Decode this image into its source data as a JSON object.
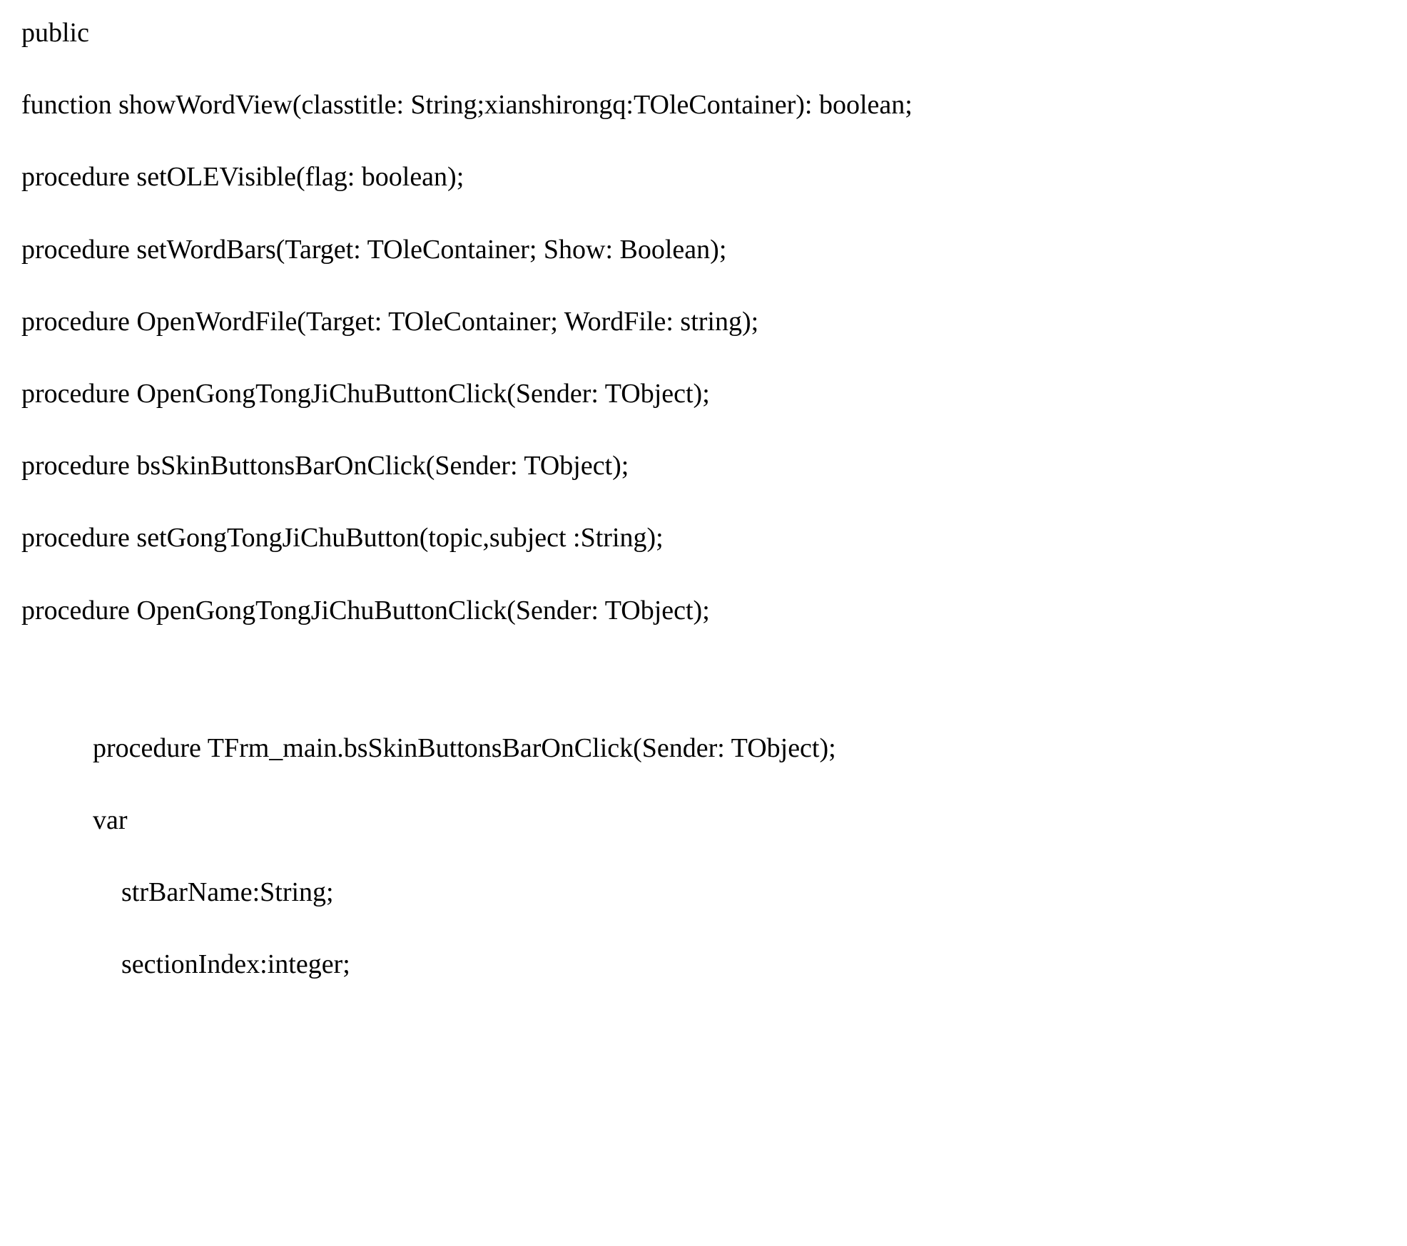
{
  "lines": {
    "l1": "public",
    "l2": "function showWordView(classtitle: String;xianshirongq:TOleContainer): boolean;",
    "l3": "procedure setOLEVisible(flag: boolean);",
    "l4": "procedure setWordBars(Target: TOleContainer; Show: Boolean);",
    "l5": "procedure OpenWordFile(Target: TOleContainer; WordFile: string);",
    "l6": "procedure OpenGongTongJiChuButtonClick(Sender: TObject);",
    "l7": "procedure bsSkinButtonsBarOnClick(Sender: TObject);",
    "l8": "procedure setGongTongJiChuButton(topic,subject :String);",
    "l9": "procedure OpenGongTongJiChuButtonClick(Sender: TObject);",
    "l10": "procedure TFrm_main.bsSkinButtonsBarOnClick(Sender: TObject);",
    "l11": "var",
    "l12": "strBarName:String;",
    "l13": "sectionIndex:integer;"
  }
}
